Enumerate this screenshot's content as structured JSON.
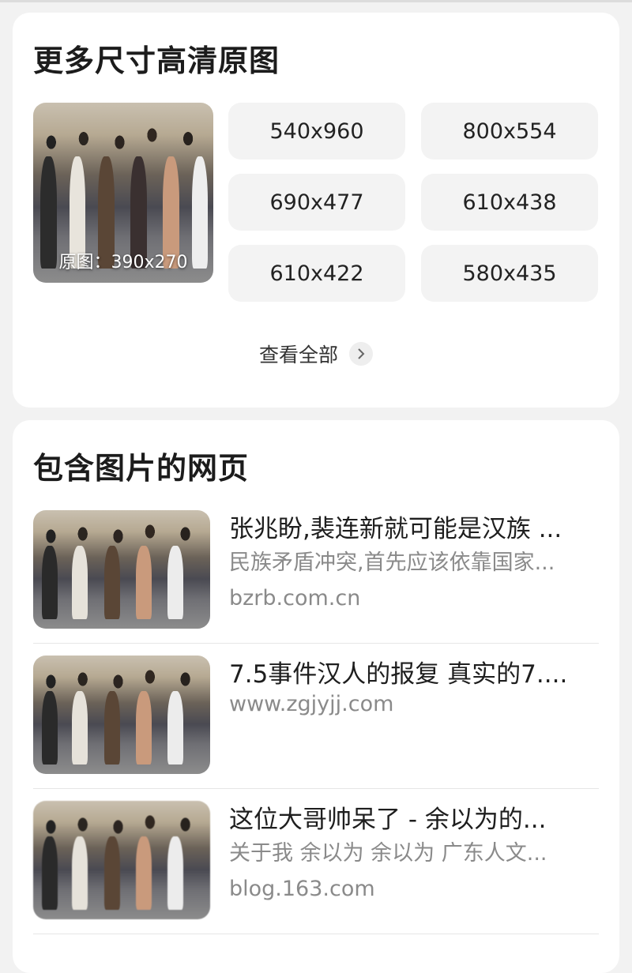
{
  "more_sizes": {
    "title": "更多尺寸高清原图",
    "original_label": "原图：390x270",
    "sizes": [
      "540x960",
      "800x554",
      "690x477",
      "610x438",
      "610x422",
      "580x435"
    ],
    "view_all": "查看全部"
  },
  "pages": {
    "title": "包含图片的网页",
    "items": [
      {
        "title": "张兆盼,裴连新就可能是汉族 ...",
        "snippet": "民族矛盾冲突,首先应该依靠国家...",
        "source": "bzrb.com.cn"
      },
      {
        "title": "7.5事件汉人的报复 真实的7....",
        "snippet": "",
        "source": "www.zgjyjj.com"
      },
      {
        "title": "这位大哥帅呆了 - 余以为的...",
        "snippet": "关于我 余以为 余以为 广东人文...",
        "source": "blog.163.com"
      }
    ]
  },
  "icons": {
    "view_all_chevron": "chevron-right-icon"
  }
}
